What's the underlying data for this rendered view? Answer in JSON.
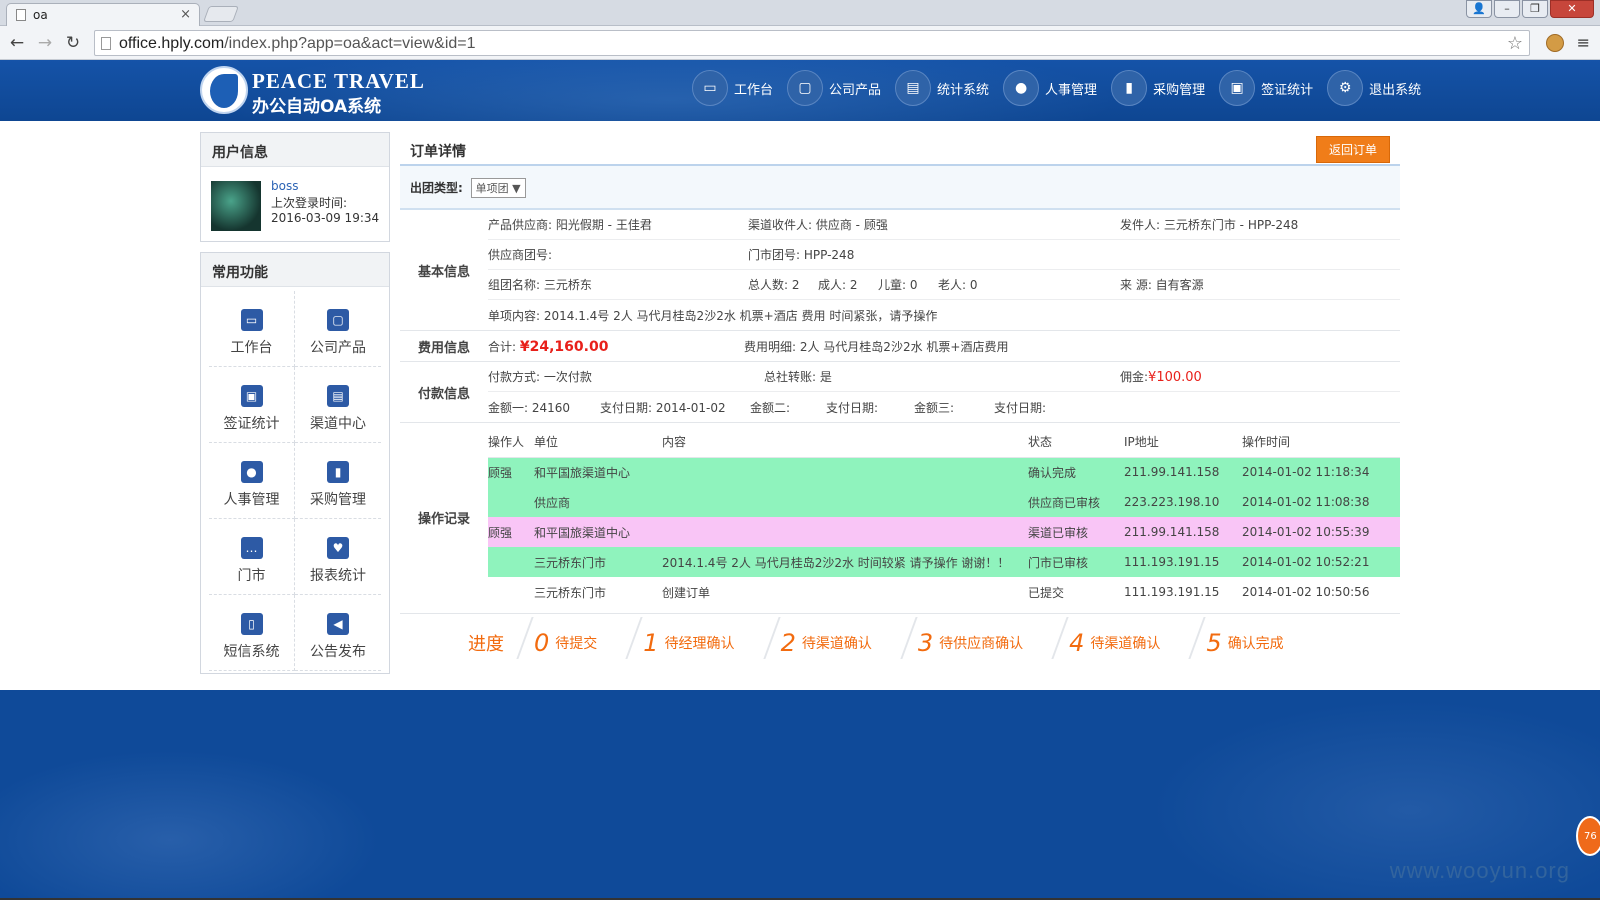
{
  "browser": {
    "tab_title": "oa",
    "tab_close": "×",
    "url_host": "office.hply.com",
    "url_path": "/index.php?app=oa&act=view&id=1"
  },
  "header": {
    "logo_en": "PEACE TRAVEL",
    "logo_cn": "办公自动OA系统",
    "nav": [
      {
        "label": "工作台",
        "icon": "monitor-icon"
      },
      {
        "label": "公司产品",
        "icon": "frame-icon"
      },
      {
        "label": "统计系统",
        "icon": "stats-icon"
      },
      {
        "label": "人事管理",
        "icon": "people-icon"
      },
      {
        "label": "采购管理",
        "icon": "purchase-icon"
      },
      {
        "label": "签证统计",
        "icon": "visa-icon"
      },
      {
        "label": "退出系统",
        "icon": "gear-icon"
      }
    ]
  },
  "sidebar": {
    "user_title": "用户信息",
    "username": "boss",
    "last_login_label": "上次登录时间:",
    "last_login_time": "2016-03-09 19:34",
    "functions_title": "常用功能",
    "functions": [
      {
        "label": "工作台",
        "icon": "monitor-icon"
      },
      {
        "label": "公司产品",
        "icon": "frame-icon"
      },
      {
        "label": "签证统计",
        "icon": "visa-icon"
      },
      {
        "label": "渠道中心",
        "icon": "channel-icon"
      },
      {
        "label": "人事管理",
        "icon": "people-icon"
      },
      {
        "label": "采购管理",
        "icon": "purchase-icon"
      },
      {
        "label": "门市",
        "icon": "chat-icon"
      },
      {
        "label": "报表统计",
        "icon": "heart-icon"
      },
      {
        "label": "短信系统",
        "icon": "phone-icon"
      },
      {
        "label": "公告发布",
        "icon": "speaker-icon"
      }
    ]
  },
  "main": {
    "title": "订单详情",
    "back_button": "返回订单",
    "group_type_label": "出团类型:",
    "group_type_value": "单项团",
    "basic": {
      "label": "基本信息",
      "supplier": "产品供应商: 阳光假期 - 王佳君",
      "channel_receiver": "渠道收件人: 供应商 - 顾强",
      "sender": "发件人: 三元桥东门市 - HPP-248",
      "supplier_group_no": "供应商团号:",
      "store_group_no": "门市团号: HPP-248",
      "group_name": "组团名称: 三元桥东",
      "total_people": "总人数: 2",
      "adults": "成人: 2",
      "children": "儿童: 0",
      "seniors": "老人: 0",
      "source": "来   源: 自有客源",
      "item_content": "单项内容: 2014.1.4号 2人 马代月桂岛2沙2水  机票+酒店 费用     时间紧张，请予操作"
    },
    "fee": {
      "label": "费用信息",
      "total_label": "合计:",
      "total_value": "¥24,160.00",
      "detail": "费用明细:   2人 马代月桂岛2沙2水 机票+酒店费用"
    },
    "payment": {
      "label": "付款信息",
      "method": "付款方式: 一次付款",
      "hq_transfer": "总社转账: 是",
      "commission_label": "佣金:",
      "commission_value": "¥100.00",
      "amount1": "金额一:   24160",
      "pay_date1": "支付日期: 2014-01-02",
      "amount2": "金额二:",
      "pay_date2": "支付日期:",
      "amount3": "金额三:",
      "pay_date3": "支付日期:"
    },
    "log": {
      "label": "操作记录",
      "columns": [
        "操作人",
        "单位",
        "内容",
        "状态",
        "IP地址",
        "操作时间"
      ],
      "rows": [
        {
          "operator": "顾强",
          "unit": "和平国旅渠道中心",
          "content": "",
          "status": "确认完成",
          "ip": "211.99.141.158",
          "time": "2014-01-02 11:18:34",
          "color": "#8ff3bd"
        },
        {
          "operator": "",
          "unit": "供应商",
          "content": "",
          "status": "供应商已审核",
          "ip": "223.223.198.10",
          "time": "2014-01-02 11:08:38",
          "color": "#8ff3bd"
        },
        {
          "operator": "顾强",
          "unit": "和平国旅渠道中心",
          "content": "",
          "status": "渠道已审核",
          "ip": "211.99.141.158",
          "time": "2014-01-02 10:55:39",
          "color": "#f9c5f6"
        },
        {
          "operator": "",
          "unit": "三元桥东门市",
          "content": "2014.1.4号 2人 马代月桂岛2沙2水 时间较紧 请予操作 谢谢！！",
          "status": "门市已审核",
          "ip": "111.193.191.15",
          "time": "2014-01-02 10:52:21",
          "color": "#8ff3bd"
        },
        {
          "operator": "",
          "unit": "三元桥东门市",
          "content": "创建订单",
          "status": "已提交",
          "ip": "111.193.191.15",
          "time": "2014-01-02 10:50:56",
          "color": "#ffffff"
        }
      ]
    },
    "progress": {
      "label": "进度",
      "steps": [
        {
          "n": "0",
          "text": "待提交"
        },
        {
          "n": "1",
          "text": "待经理确认"
        },
        {
          "n": "2",
          "text": "待渠道确认"
        },
        {
          "n": "3",
          "text": "待供应商确认"
        },
        {
          "n": "4",
          "text": "待渠道确认"
        },
        {
          "n": "5",
          "text": "确认完成"
        }
      ]
    }
  },
  "footer": {
    "badge": "76",
    "watermark": "www.wooyun.org"
  }
}
